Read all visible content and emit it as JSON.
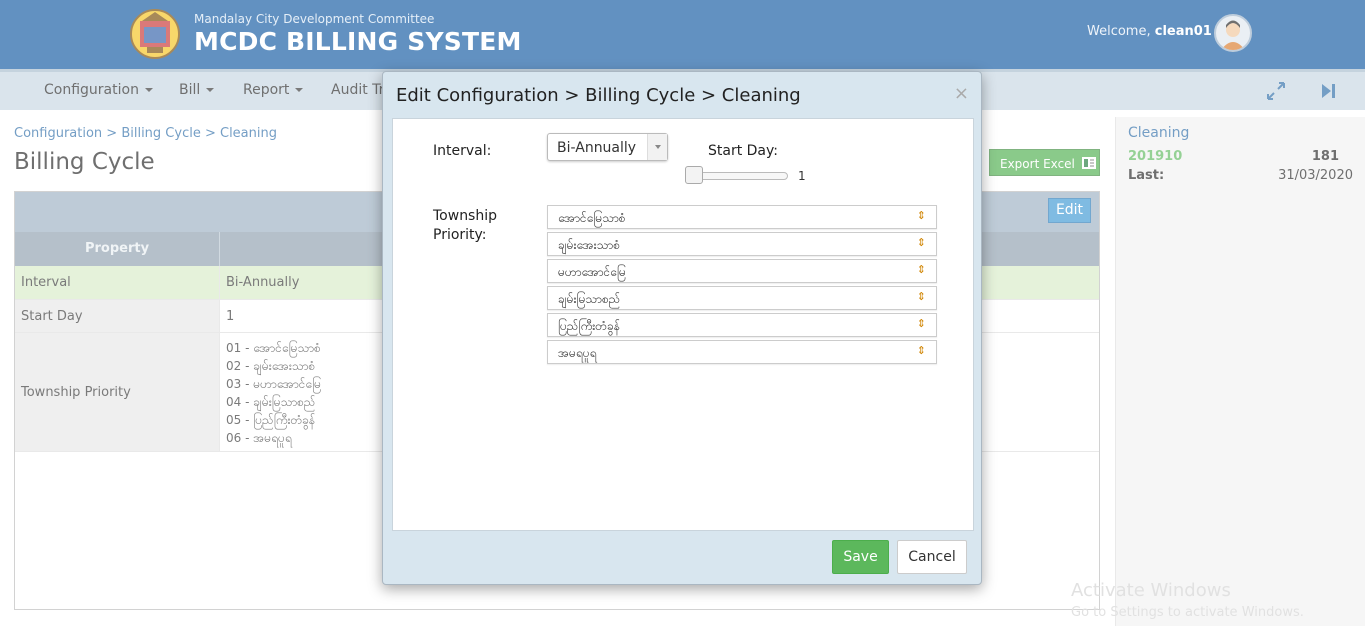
{
  "header": {
    "org_name": "Mandalay City Development Committee",
    "system_name": "MCDC BILLING SYSTEM",
    "welcome_prefix": "Welcome, ",
    "username": "clean01",
    "brand_color": "#0f57a0"
  },
  "nav": {
    "items": [
      {
        "label": "Configuration",
        "has_caret": true
      },
      {
        "label": "Bill",
        "has_caret": true
      },
      {
        "label": "Report",
        "has_caret": true
      },
      {
        "label": "Audit Tr",
        "has_caret": false
      }
    ],
    "right_icons": [
      "expand-icon",
      "skip-forward-icon"
    ]
  },
  "main": {
    "breadcrumb": "Configuration > Billing Cycle > Cleaning",
    "title": "Billing Cycle",
    "export_label": "Export Excel",
    "edit_label": "Edit",
    "table": {
      "header_property": "Property",
      "rows": [
        {
          "key": "Interval",
          "value": "Bi-Annually"
        },
        {
          "key": "Start Day",
          "value": "1"
        },
        {
          "key": "Township Priority",
          "values": [
            "01 - အောင်မြေသာစံ",
            "02 - ချမ်းအေးသာစံ",
            "03 - မဟာအောင်မြေ",
            "04 - ချမ်းမြသာစည်",
            "05 - ပြည်ကြီးတံခွန်",
            "06 - အမရပူရ"
          ]
        }
      ]
    }
  },
  "side": {
    "title": "Cleaning",
    "code": "201910",
    "count": "181",
    "last_label": "Last:",
    "last_date": "31/03/2020"
  },
  "watermark": {
    "line1": "Activate Windows",
    "line2": "Go to Settings to activate Windows."
  },
  "modal": {
    "title": "Edit Configuration > Billing Cycle > Cleaning",
    "close": "×",
    "interval_label": "Interval:",
    "interval_value": "Bi-Annually",
    "start_day_label": "Start Day:",
    "start_day_value": "1",
    "township_label_1": "Township",
    "township_label_2": "Priority:",
    "township_items": [
      "အောင်မြေသာစံ",
      "ချမ်းအေးသာစံ",
      "မဟာအောင်မြေ",
      "ချမ်းမြသာစည်",
      "ပြည်ကြီးတံခွန်",
      "အမရပူရ"
    ],
    "sort_glyph": "⇕",
    "save_label": "Save",
    "cancel_label": "Cancel"
  }
}
